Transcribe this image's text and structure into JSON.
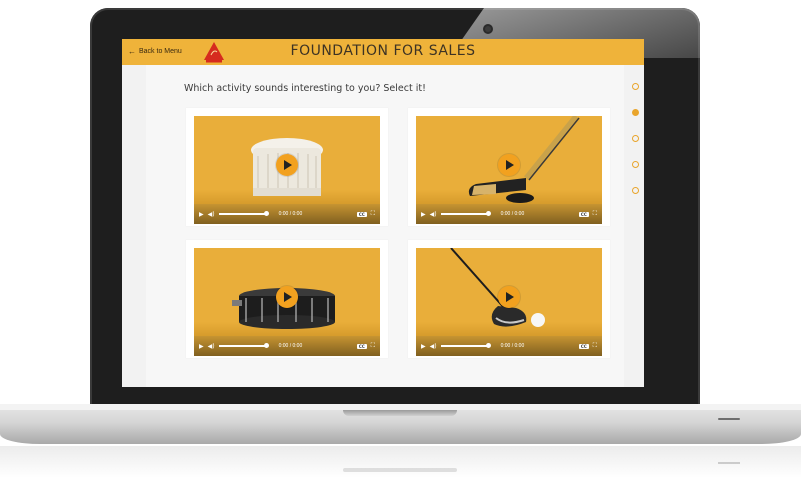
{
  "header": {
    "back_label": "Back to Menu",
    "title": "FOUNDATION FOR SALES",
    "background": "#efb33a"
  },
  "main": {
    "question": "Which activity sounds interesting to you? Select it!"
  },
  "progress_dots": {
    "count": 5,
    "active_index": 1,
    "accent": "#e9a52c"
  },
  "videos": [
    {
      "subject": "chef-hat",
      "time": "0:00 / 0:00",
      "cc": "CC"
    },
    {
      "subject": "hockey-stick",
      "time": "0:00 / 0:00",
      "cc": "CC"
    },
    {
      "subject": "snare-drum",
      "time": "0:00 / 0:00",
      "cc": "CC"
    },
    {
      "subject": "golf-club",
      "time": "0:00 / 0:00",
      "cc": "CC"
    }
  ]
}
